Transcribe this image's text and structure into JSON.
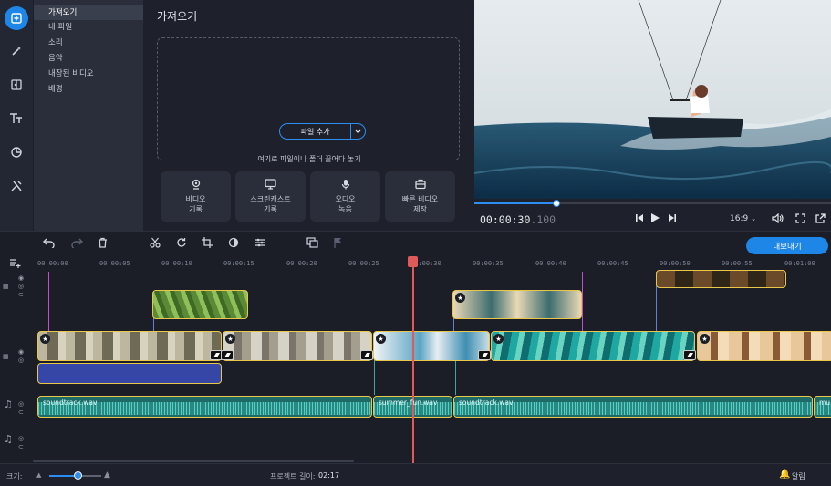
{
  "sidebar": {
    "items": [
      {
        "label": "가져오기",
        "active": true
      },
      {
        "label": "내 파일"
      },
      {
        "label": "소리"
      },
      {
        "label": "음악"
      },
      {
        "label": "내장된 비디오"
      },
      {
        "label": "배경"
      }
    ]
  },
  "rail_icons": [
    "import-icon",
    "magic-wand-icon",
    "transitions-icon",
    "text-icon",
    "sticker-icon",
    "tools-icon"
  ],
  "import_panel": {
    "title": "가져오기",
    "add_file_label": "파일 추가",
    "drop_hint": "여기로 파일이나 폴더 끌어다 놓기",
    "quick_buttons": [
      {
        "line1": "비디오",
        "line2": "기록",
        "icon": "webcam-icon"
      },
      {
        "line1": "스크린캐스트",
        "line2": "기록",
        "icon": "monitor-icon"
      },
      {
        "line1": "오디오",
        "line2": "녹음",
        "icon": "microphone-icon"
      },
      {
        "line1": "빠른 비디오",
        "line2": "제작",
        "icon": "quick-video-icon"
      }
    ]
  },
  "player": {
    "timecode_main": "00:00:30",
    "timecode_ms": ".100",
    "aspect_ratio": "16:9",
    "progress_fraction": 0.23
  },
  "toolbar": {
    "export_label": "내보내기"
  },
  "ruler": {
    "ticks": [
      "00:00:00",
      "00:00:05",
      "00:00:10",
      "00:00:15",
      "00:00:20",
      "00:00:25",
      "00:00:30",
      "00:00:35",
      "00:00:40",
      "00:00:45",
      "00:00:50",
      "00:00:55",
      "00:01:00"
    ]
  },
  "timeline": {
    "audio_clips": [
      "soundtrack.wav",
      "summer_fun.wav",
      "soundtrack.wav",
      "mu"
    ]
  },
  "status": {
    "size_label": "크기:",
    "project_length_label": "프로젝트 길이:",
    "project_length_value": "02:17",
    "notifications_label": "알림",
    "zoom_fraction": 0.55
  },
  "colors": {
    "accent": "#1e86e6",
    "clip_border": "#e8c74a",
    "playhead": "#e05a5a",
    "audio_clip": "#1d6a66"
  }
}
